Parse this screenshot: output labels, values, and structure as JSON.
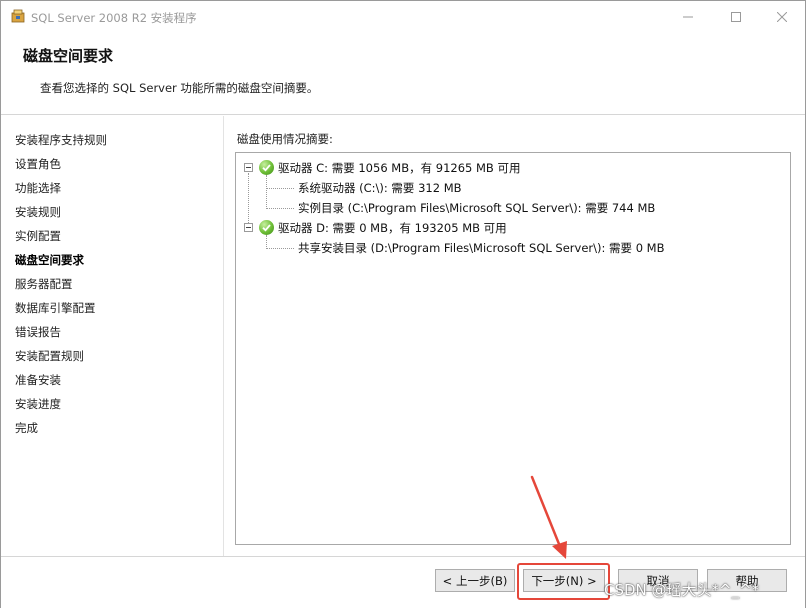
{
  "window": {
    "title": "SQL Server 2008 R2 安装程序"
  },
  "header": {
    "title": "磁盘空间要求",
    "subtitle": "查看您选择的 SQL Server 功能所需的磁盘空间摘要。"
  },
  "sidebar": {
    "items": [
      {
        "label": "安装程序支持规则"
      },
      {
        "label": "设置角色"
      },
      {
        "label": "功能选择"
      },
      {
        "label": "安装规则"
      },
      {
        "label": "实例配置"
      },
      {
        "label": "磁盘空间要求"
      },
      {
        "label": "服务器配置"
      },
      {
        "label": "数据库引擎配置"
      },
      {
        "label": "错误报告"
      },
      {
        "label": "安装配置规则"
      },
      {
        "label": "准备安装"
      },
      {
        "label": "安装进度"
      },
      {
        "label": "完成"
      }
    ],
    "active_index": 5
  },
  "main": {
    "summary_label": "磁盘使用情况摘要:",
    "tree": {
      "drive_c": "驱动器 C: 需要 1056 MB，有 91265 MB 可用",
      "drive_c_system": "系统驱动器 (C:\\): 需要 312 MB",
      "drive_c_instance": "实例目录 (C:\\Program Files\\Microsoft SQL Server\\): 需要 744 MB",
      "drive_d": "驱动器 D: 需要 0 MB，有 193205 MB 可用",
      "drive_d_shared": "共享安装目录 (D:\\Program Files\\Microsoft SQL Server\\): 需要 0 MB"
    }
  },
  "footer": {
    "prev_label": "< 上一步(B)",
    "next_label": "下一步(N) >",
    "cancel_label": "取消",
    "help_label": "帮助"
  },
  "watermark": "CSDN @瑶大头*^_^*",
  "colors": {
    "highlight": "#e5473a",
    "check": "#6cbd35"
  }
}
